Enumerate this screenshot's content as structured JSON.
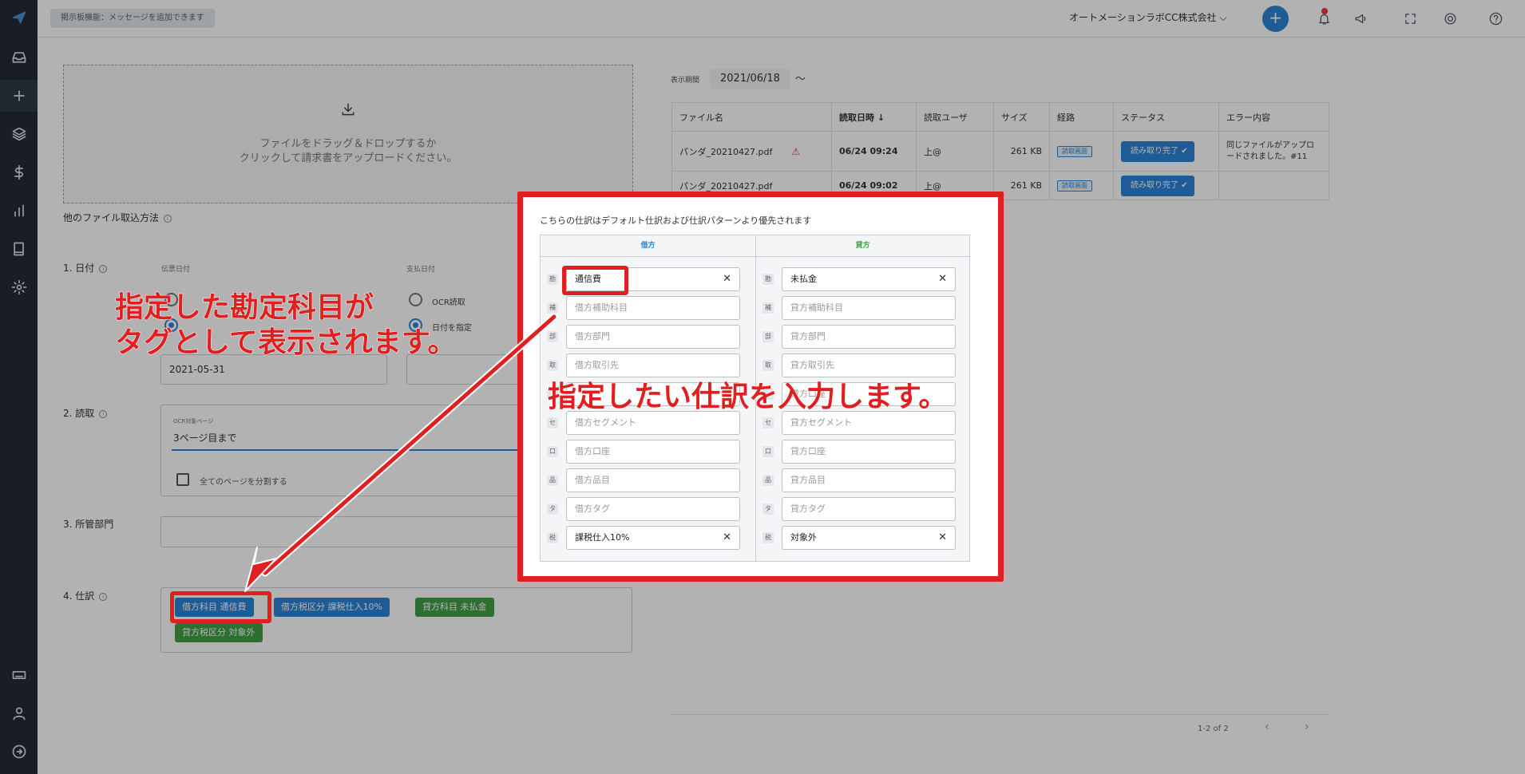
{
  "topbar": {
    "notice": "掲示板機能：メッセージを追加できます",
    "company": "オートメーションラボCC株式会社 ⌵"
  },
  "upload": {
    "line1": "ファイルをドラッグ＆ドロップするか",
    "line2": "クリックして請求書をアップロードください。",
    "other_methods": "他のファイル取込方法"
  },
  "form": {
    "date_section": "1. 日付",
    "voucher_date_label": "伝票日付",
    "payment_date_label": "支払日付",
    "ocr_read": "OCR読取",
    "specify_date": "日付を指定",
    "date_value": "2021-05-31",
    "read_section": "2. 読取",
    "ocr_pages_label": "OCR対象ページ",
    "ocr_pages_value": "3ページ目まで",
    "split_pages": "全てのページを分割する",
    "dept_section": "3. 所管部門",
    "journal_section": "4. 仕訳"
  },
  "tags": [
    {
      "text": "借方科目  通信費",
      "color": "blue"
    },
    {
      "text": "借方税区分  課税仕入10%",
      "color": "blue"
    },
    {
      "text": "貸方科目  未払金",
      "color": "green"
    },
    {
      "text": "貸方税区分  対象外",
      "color": "green"
    }
  ],
  "files": {
    "period_label": "表示期間",
    "period_value": "2021/06/18",
    "period_tilde": "〜",
    "columns": [
      "ファイル名",
      "読取日時 ↓",
      "読取ユーザ",
      "サイズ",
      "経路",
      "ステータス",
      "エラー内容"
    ],
    "rows": [
      {
        "name": "パンダ_20210427.pdf",
        "date": "06/24  09:24",
        "user": "上@",
        "size": "261 KB",
        "route": "読取画面",
        "status": "読み取り完了",
        "error": "同じファイルがアップロードされました。#11"
      },
      {
        "name": "パンダ_20210427.pdf",
        "date": "06/24  09:02",
        "user": "上@",
        "size": "261 KB",
        "route": "読取画面",
        "status": "読み取り完了",
        "error": ""
      }
    ],
    "pager": "1-2 of 2"
  },
  "modal": {
    "note": "こちらの仕訳はデフォルト仕訳および仕訳パターンより優先されます",
    "debit_head": "借方",
    "credit_head": "貸方",
    "debit_color": "#2d84d6",
    "credit_color": "#43a047",
    "row_labels": [
      "勘",
      "補",
      "部",
      "取",
      "",
      "セ",
      "口",
      "品",
      "タ",
      "税"
    ],
    "debit": [
      "通信費",
      "借方補助科目",
      "借方部門",
      "借方取引先",
      "",
      "借方セグメント",
      "借方口座",
      "借方品目",
      "借方タグ",
      "課税仕入10%"
    ],
    "credit": [
      "未払金",
      "貸方補助科目",
      "貸方部門",
      "貸方取引先",
      "貸方口座",
      "貸方セグメント",
      "貸方口座",
      "貸方品目",
      "貸方タグ",
      "対象外"
    ]
  },
  "annotations": {
    "left_line1": "指定した勘定科目が",
    "left_line2": "タグとして表示されます。",
    "center": "指定したい仕訳を入力します。"
  }
}
